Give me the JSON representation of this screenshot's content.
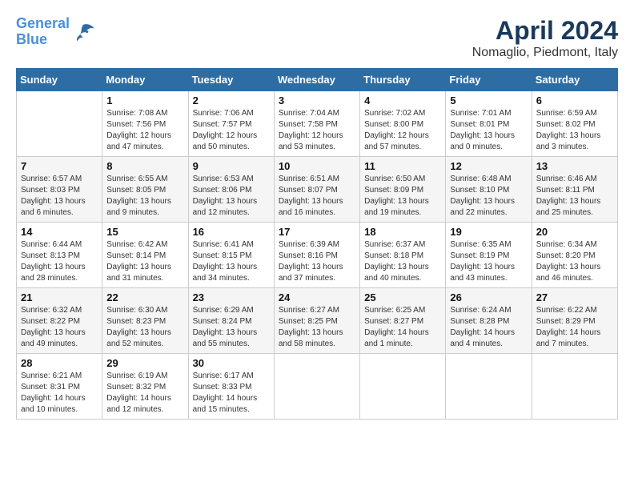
{
  "header": {
    "logo_line1": "General",
    "logo_line2": "Blue",
    "main_title": "April 2024",
    "subtitle": "Nomaglio, Piedmont, Italy"
  },
  "weekdays": [
    "Sunday",
    "Monday",
    "Tuesday",
    "Wednesday",
    "Thursday",
    "Friday",
    "Saturday"
  ],
  "weeks": [
    [
      {
        "day": "",
        "info": ""
      },
      {
        "day": "1",
        "info": "Sunrise: 7:08 AM\nSunset: 7:56 PM\nDaylight: 12 hours\nand 47 minutes."
      },
      {
        "day": "2",
        "info": "Sunrise: 7:06 AM\nSunset: 7:57 PM\nDaylight: 12 hours\nand 50 minutes."
      },
      {
        "day": "3",
        "info": "Sunrise: 7:04 AM\nSunset: 7:58 PM\nDaylight: 12 hours\nand 53 minutes."
      },
      {
        "day": "4",
        "info": "Sunrise: 7:02 AM\nSunset: 8:00 PM\nDaylight: 12 hours\nand 57 minutes."
      },
      {
        "day": "5",
        "info": "Sunrise: 7:01 AM\nSunset: 8:01 PM\nDaylight: 13 hours\nand 0 minutes."
      },
      {
        "day": "6",
        "info": "Sunrise: 6:59 AM\nSunset: 8:02 PM\nDaylight: 13 hours\nand 3 minutes."
      }
    ],
    [
      {
        "day": "7",
        "info": "Sunrise: 6:57 AM\nSunset: 8:03 PM\nDaylight: 13 hours\nand 6 minutes."
      },
      {
        "day": "8",
        "info": "Sunrise: 6:55 AM\nSunset: 8:05 PM\nDaylight: 13 hours\nand 9 minutes."
      },
      {
        "day": "9",
        "info": "Sunrise: 6:53 AM\nSunset: 8:06 PM\nDaylight: 13 hours\nand 12 minutes."
      },
      {
        "day": "10",
        "info": "Sunrise: 6:51 AM\nSunset: 8:07 PM\nDaylight: 13 hours\nand 16 minutes."
      },
      {
        "day": "11",
        "info": "Sunrise: 6:50 AM\nSunset: 8:09 PM\nDaylight: 13 hours\nand 19 minutes."
      },
      {
        "day": "12",
        "info": "Sunrise: 6:48 AM\nSunset: 8:10 PM\nDaylight: 13 hours\nand 22 minutes."
      },
      {
        "day": "13",
        "info": "Sunrise: 6:46 AM\nSunset: 8:11 PM\nDaylight: 13 hours\nand 25 minutes."
      }
    ],
    [
      {
        "day": "14",
        "info": "Sunrise: 6:44 AM\nSunset: 8:13 PM\nDaylight: 13 hours\nand 28 minutes."
      },
      {
        "day": "15",
        "info": "Sunrise: 6:42 AM\nSunset: 8:14 PM\nDaylight: 13 hours\nand 31 minutes."
      },
      {
        "day": "16",
        "info": "Sunrise: 6:41 AM\nSunset: 8:15 PM\nDaylight: 13 hours\nand 34 minutes."
      },
      {
        "day": "17",
        "info": "Sunrise: 6:39 AM\nSunset: 8:16 PM\nDaylight: 13 hours\nand 37 minutes."
      },
      {
        "day": "18",
        "info": "Sunrise: 6:37 AM\nSunset: 8:18 PM\nDaylight: 13 hours\nand 40 minutes."
      },
      {
        "day": "19",
        "info": "Sunrise: 6:35 AM\nSunset: 8:19 PM\nDaylight: 13 hours\nand 43 minutes."
      },
      {
        "day": "20",
        "info": "Sunrise: 6:34 AM\nSunset: 8:20 PM\nDaylight: 13 hours\nand 46 minutes."
      }
    ],
    [
      {
        "day": "21",
        "info": "Sunrise: 6:32 AM\nSunset: 8:22 PM\nDaylight: 13 hours\nand 49 minutes."
      },
      {
        "day": "22",
        "info": "Sunrise: 6:30 AM\nSunset: 8:23 PM\nDaylight: 13 hours\nand 52 minutes."
      },
      {
        "day": "23",
        "info": "Sunrise: 6:29 AM\nSunset: 8:24 PM\nDaylight: 13 hours\nand 55 minutes."
      },
      {
        "day": "24",
        "info": "Sunrise: 6:27 AM\nSunset: 8:25 PM\nDaylight: 13 hours\nand 58 minutes."
      },
      {
        "day": "25",
        "info": "Sunrise: 6:25 AM\nSunset: 8:27 PM\nDaylight: 14 hours\nand 1 minute."
      },
      {
        "day": "26",
        "info": "Sunrise: 6:24 AM\nSunset: 8:28 PM\nDaylight: 14 hours\nand 4 minutes."
      },
      {
        "day": "27",
        "info": "Sunrise: 6:22 AM\nSunset: 8:29 PM\nDaylight: 14 hours\nand 7 minutes."
      }
    ],
    [
      {
        "day": "28",
        "info": "Sunrise: 6:21 AM\nSunset: 8:31 PM\nDaylight: 14 hours\nand 10 minutes."
      },
      {
        "day": "29",
        "info": "Sunrise: 6:19 AM\nSunset: 8:32 PM\nDaylight: 14 hours\nand 12 minutes."
      },
      {
        "day": "30",
        "info": "Sunrise: 6:17 AM\nSunset: 8:33 PM\nDaylight: 14 hours\nand 15 minutes."
      },
      {
        "day": "",
        "info": ""
      },
      {
        "day": "",
        "info": ""
      },
      {
        "day": "",
        "info": ""
      },
      {
        "day": "",
        "info": ""
      }
    ]
  ]
}
